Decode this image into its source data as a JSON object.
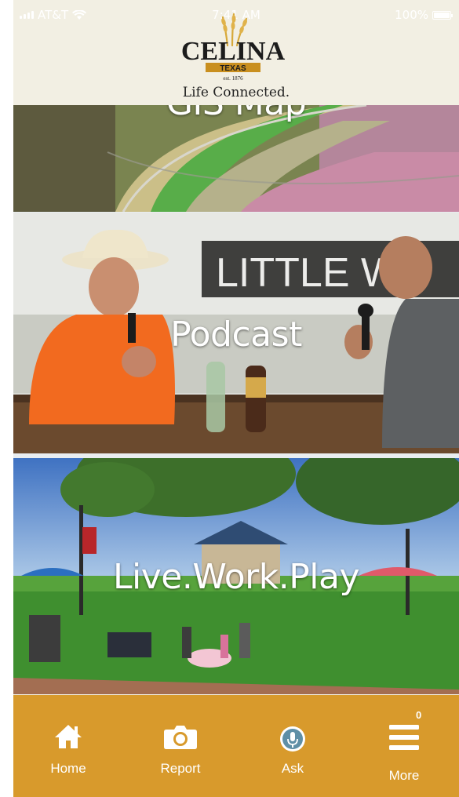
{
  "status_bar": {
    "carrier": "AT&T",
    "time": "7:41 AM",
    "battery": "100%",
    "battery_level": 1.0
  },
  "header": {
    "logo_text": "CELINA",
    "logo_state": "TEXAS",
    "logo_est": "est. 1876",
    "tagline": "Life Connected."
  },
  "tiles": [
    {
      "label": "GIS Map"
    },
    {
      "label": "Podcast",
      "sign_text": "LITTLE WO"
    },
    {
      "label": "Live.Work.Play"
    }
  ],
  "tabbar": {
    "items": [
      {
        "label": "Home",
        "icon": "home-icon"
      },
      {
        "label": "Report",
        "icon": "camera-icon"
      },
      {
        "label": "Ask",
        "icon": "microphone-icon"
      },
      {
        "label": "More",
        "icon": "menu-icon",
        "badge": "0"
      }
    ]
  },
  "colors": {
    "tabbar": "#d89a2c",
    "header": "#f2efe3",
    "logo_gold": "#c98f1f"
  }
}
